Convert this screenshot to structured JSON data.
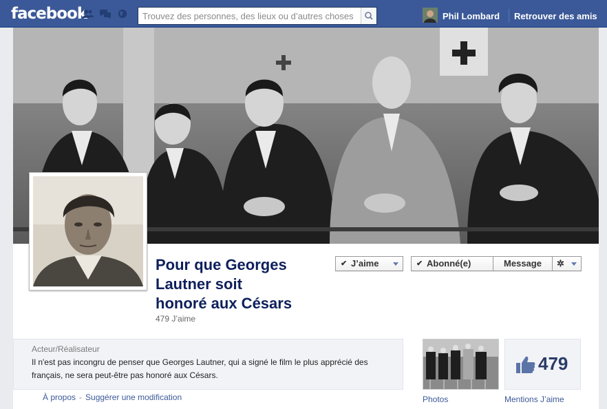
{
  "topbar": {
    "logo": "facebook",
    "search_placeholder": "Trouvez des personnes, des lieux ou d’autres choses",
    "user_name": "Phil Lombard",
    "find_friends": "Retrouver des amis"
  },
  "page": {
    "title_lines": [
      "Pour que Georges",
      "Lautner soit",
      "honoré aux Césars"
    ],
    "likes_count": "479 J’aime",
    "buttons": {
      "like": "J’aime",
      "subscribed": "Abonné(e)",
      "message": "Message"
    },
    "about": {
      "category": "Acteur/Réalisateur",
      "description": "Il n'est pas incongru de penser que Georges Lautner, qui a signé le film le plus apprécié des français, ne sera peut-être pas honoré aux Césars.",
      "link_about": "À propos",
      "link_sep": "-",
      "link_suggest": "Suggérer une modification"
    },
    "photos_label": "Photos",
    "likes_box": {
      "number": "479",
      "label": "Mentions J’aime"
    }
  },
  "colors": {
    "topbar": "#3b5998",
    "title": "#0e1f5b",
    "link": "#3b5998"
  }
}
